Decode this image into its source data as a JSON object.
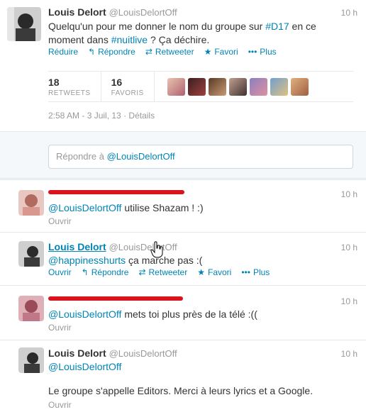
{
  "main": {
    "author_name": "Louis Delort",
    "author_handle": "@LouisDelortOff",
    "time": "10 h",
    "text_1": "Quelqu'un pour me donner le nom du groupe sur ",
    "hashtag_1": "#D17",
    "text_2": " en ce",
    "text_3": "moment dans ",
    "hashtag_2": "#nuitlive",
    "text_4": " ? Ça déchire.",
    "actions": {
      "collapse": "Réduire",
      "reply": "Répondre",
      "retweet": "Retweeter",
      "favorite": "Favori",
      "more": "Plus"
    },
    "stats": {
      "retweets_count": "18",
      "retweets_label": "RETWEETS",
      "favorites_count": "16",
      "favorites_label": "FAVORIS"
    },
    "timestamp": "2:58 AM - 3 Juil, 13",
    "details": "Détails",
    "reply_placeholder": "Répondre à ",
    "reply_mention": "@LouisDelortOff"
  },
  "replies": [
    {
      "time": "10 h",
      "mention": "@LouisDelortOff",
      "text": " utilise Shazam ! :)",
      "open": "Ouvrir"
    },
    {
      "author_name": "Louis Delort",
      "author_handle": "@LouisDelortOff",
      "time": "10 h",
      "mention": "@happinesshurts",
      "text": " ça marche pas :(",
      "open": "Ouvrir",
      "actions": {
        "reply": "Répondre",
        "retweet": "Retweeter",
        "favorite": "Favori",
        "more": "Plus"
      }
    },
    {
      "time": "10 h",
      "mention": "@LouisDelortOff",
      "text": " mets toi plus près de la télé :((",
      "open": "Ouvrir"
    },
    {
      "author_name": "Louis Delort",
      "author_handle": "@LouisDelortOff",
      "time": "10 h",
      "mention": "@LouisDelortOff",
      "text": "Le groupe s'appelle Editors. Merci à leurs lyrics et a Google.",
      "open": "Ouvrir"
    }
  ],
  "colors": {
    "link": "#0084b4",
    "redaction": "#d9141c"
  }
}
